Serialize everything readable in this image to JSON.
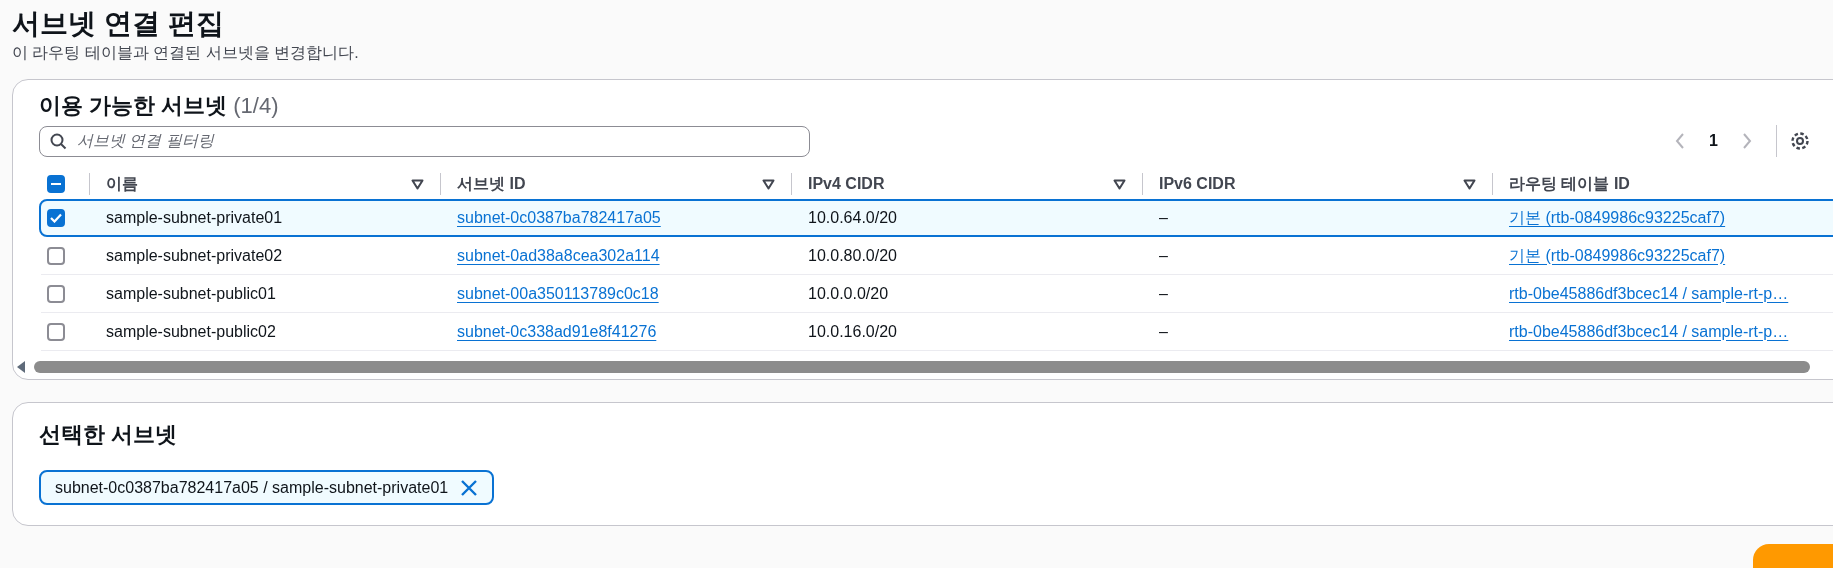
{
  "page": {
    "title": "서브넷 연결 편집",
    "description": "이 라우팅 테이블과 연결된 서브넷을 변경합니다."
  },
  "available": {
    "title": "이용 가능한 서브넷",
    "count": "(1/4)",
    "search": {
      "placeholder": "서브넷 연결 필터링"
    },
    "pagination": {
      "page": "1",
      "prev_disabled": true,
      "next_disabled": true
    },
    "select_all": {
      "indeterminate": true
    },
    "columns": [
      {
        "label": "이름",
        "kind": "text",
        "sortable": true
      },
      {
        "label": "서브넷 ID",
        "kind": "link",
        "sortable": true
      },
      {
        "label": "IPv4 CIDR",
        "kind": "text",
        "sortable": true
      },
      {
        "label": "IPv6 CIDR",
        "kind": "text",
        "sortable": true
      },
      {
        "label": "라우팅 테이블 ID",
        "kind": "link"
      }
    ],
    "rows": [
      {
        "selected": true,
        "cells": [
          "sample-subnet-private01",
          "subnet-0c0387ba782417a05",
          "10.0.64.0/20",
          "–",
          "기본 (rtb-0849986c93225caf7)"
        ]
      },
      {
        "selected": false,
        "cells": [
          "sample-subnet-private02",
          "subnet-0ad38a8cea302a114",
          "10.0.80.0/20",
          "–",
          "기본 (rtb-0849986c93225caf7)"
        ]
      },
      {
        "selected": false,
        "cells": [
          "sample-subnet-public01",
          "subnet-00a350113789c0c18",
          "10.0.0.0/20",
          "–",
          "rtb-0be45886df3bcec14 / sample-rt-p…"
        ]
      },
      {
        "selected": false,
        "cells": [
          "sample-subnet-public02",
          "subnet-0c338ad91e8f41276",
          "10.0.16.0/20",
          "–",
          "rtb-0be45886df3bcec14 / sample-rt-p…"
        ]
      }
    ]
  },
  "selected_panel": {
    "title": "선택한 서브넷",
    "tokens": [
      {
        "label": "subnet-0c0387ba782417a05 / sample-subnet-private01"
      }
    ]
  }
}
